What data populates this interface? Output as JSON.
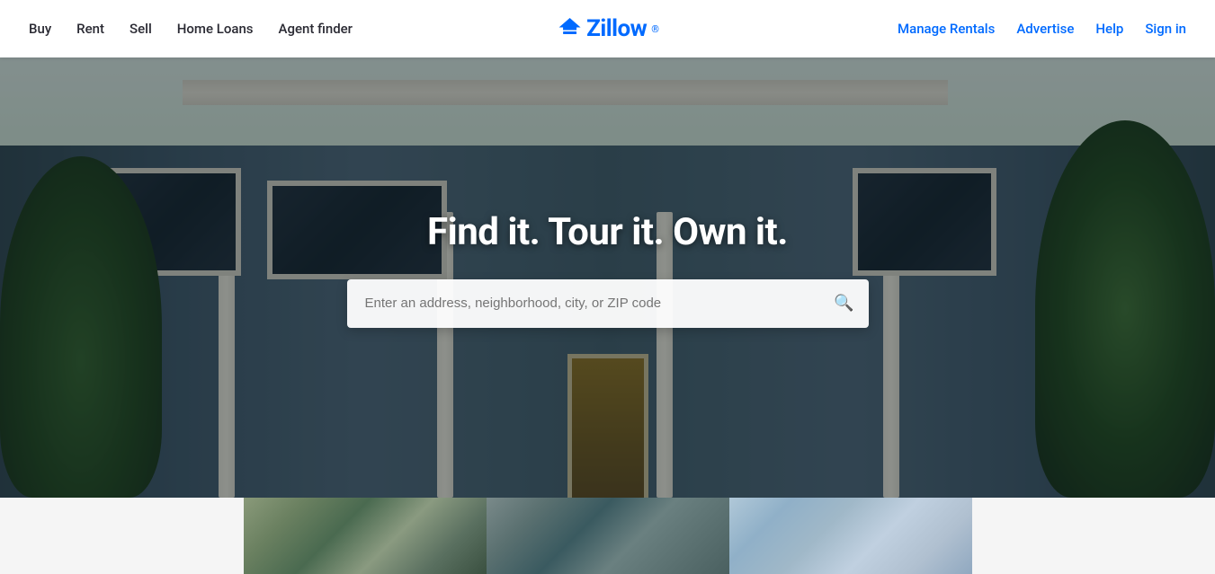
{
  "header": {
    "nav_left": [
      {
        "label": "Buy",
        "id": "buy"
      },
      {
        "label": "Rent",
        "id": "rent"
      },
      {
        "label": "Sell",
        "id": "sell"
      },
      {
        "label": "Home Loans",
        "id": "home-loans"
      },
      {
        "label": "Agent finder",
        "id": "agent-finder"
      }
    ],
    "nav_right": [
      {
        "label": "Manage Rentals",
        "id": "manage-rentals"
      },
      {
        "label": "Advertise",
        "id": "advertise"
      },
      {
        "label": "Help",
        "id": "help"
      },
      {
        "label": "Sign in",
        "id": "sign-in"
      }
    ],
    "logo_text": "Zillow",
    "logo_trademark": "®"
  },
  "hero": {
    "headline": "Find it. Tour it. Own it.",
    "search_placeholder": "Enter an address, neighborhood, city, or ZIP code"
  },
  "cards": [
    {
      "id": "card1",
      "bg_class": "card1-bg"
    },
    {
      "id": "card2",
      "bg_class": "card2-bg"
    },
    {
      "id": "card3",
      "bg_class": "card3-bg"
    }
  ]
}
